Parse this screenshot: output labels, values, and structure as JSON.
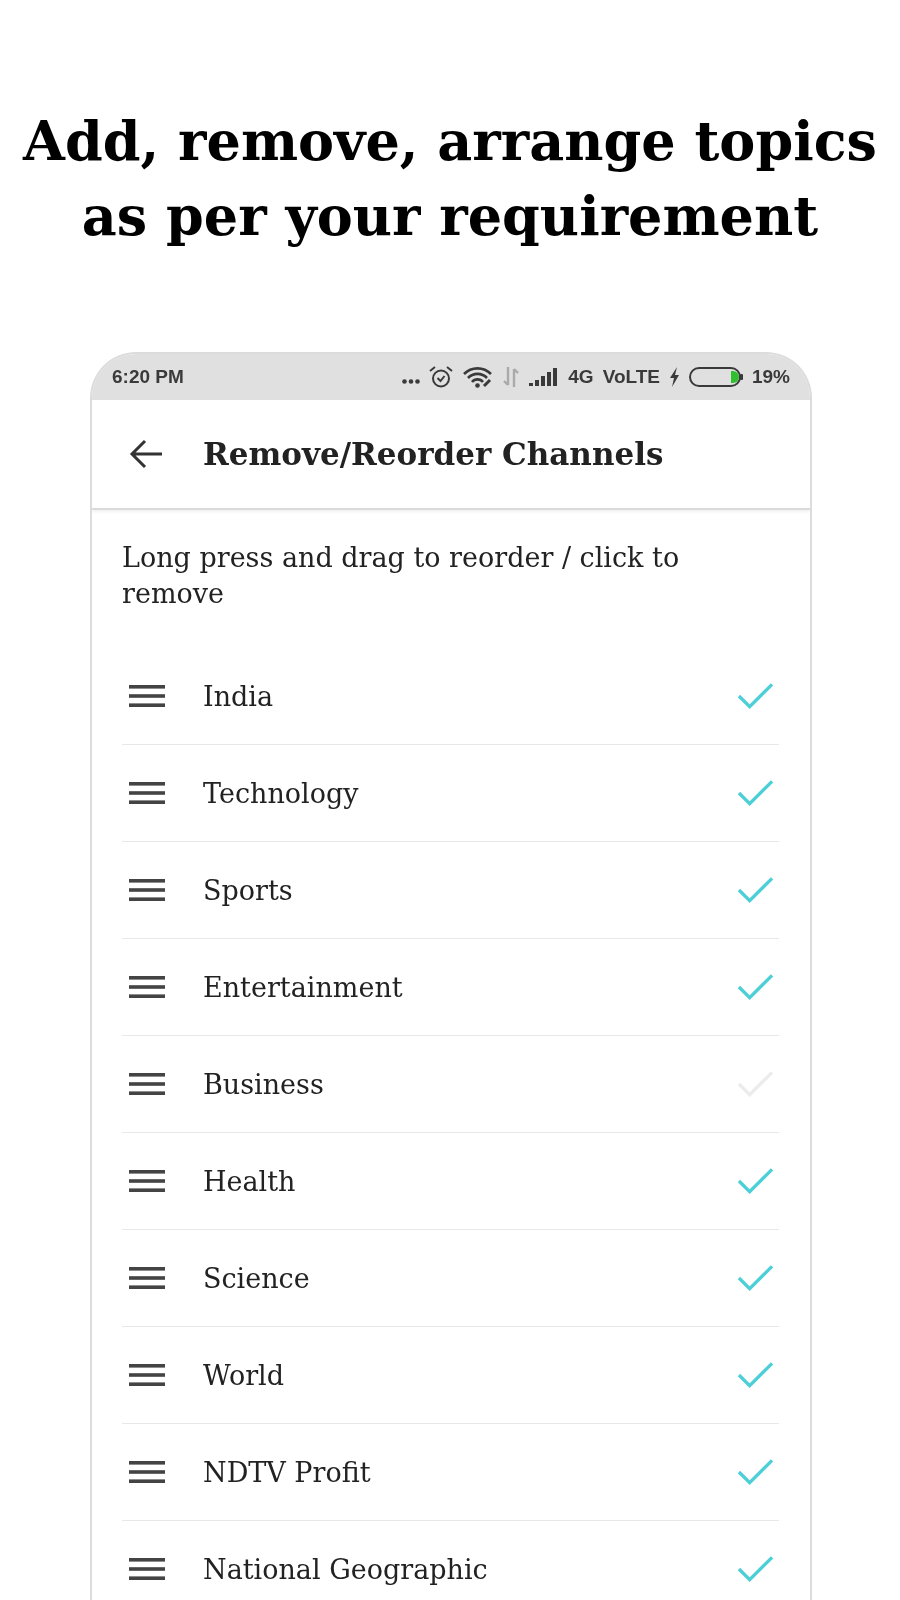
{
  "headline": "Add, remove, arrange topics as per your requirement",
  "status_bar": {
    "time": "6:20 PM",
    "network": "4G",
    "volte": "VoLTE",
    "battery": "19%"
  },
  "app_bar": {
    "title": "Remove/Reorder Channels"
  },
  "instruction": "Long press and drag to reorder / click to remove",
  "channels": [
    {
      "name": "India",
      "checked": true
    },
    {
      "name": "Technology",
      "checked": true
    },
    {
      "name": "Sports",
      "checked": true
    },
    {
      "name": "Entertainment",
      "checked": true
    },
    {
      "name": "Business",
      "checked": false
    },
    {
      "name": "Health",
      "checked": true
    },
    {
      "name": "Science",
      "checked": true
    },
    {
      "name": "World",
      "checked": true
    },
    {
      "name": "NDTV Profit",
      "checked": true
    },
    {
      "name": "National Geographic",
      "checked": true
    }
  ]
}
